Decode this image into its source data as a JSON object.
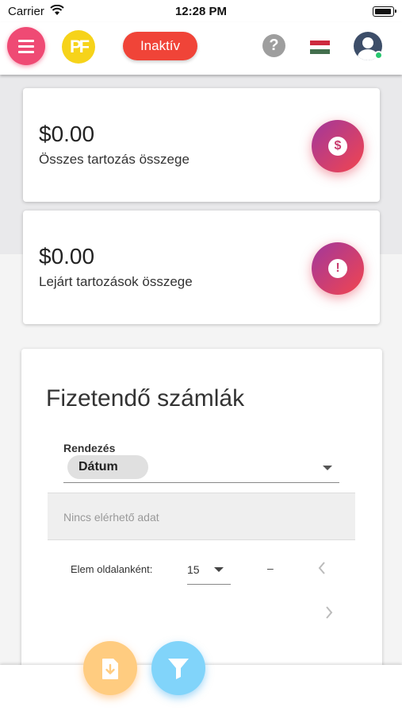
{
  "status_bar": {
    "carrier": "Carrier",
    "time": "12:28 PM"
  },
  "app_bar": {
    "logo_text": "PF",
    "status_label": "Inaktív",
    "help_label": "?",
    "accent_color": "#ef4a74",
    "status_color": "#f04438",
    "language_flag": "hungarian-flag",
    "flag_colors": [
      "#cd2a3e",
      "#ffffff",
      "#436f4d"
    ]
  },
  "summary": {
    "total": {
      "value": "$0.00",
      "label": "Összes tartozás összege",
      "icon": "dollar-icon"
    },
    "overdue": {
      "value": "$0.00",
      "label": "Lejárt tartozások összege",
      "icon": "exclamation-icon"
    }
  },
  "invoices": {
    "title": "Fizetendő számlák",
    "sort": {
      "label": "Rendezés",
      "selected": "Dátum"
    },
    "empty_text": "Nincs elérhető adat",
    "pagination": {
      "per_page_label": "Elem oldalanként:",
      "per_page_value": "15",
      "range": "–"
    }
  },
  "fabs": [
    {
      "icon": "file-download-icon",
      "color": "#ffcc80"
    },
    {
      "icon": "filter-icon",
      "color": "#81d4fa"
    }
  ]
}
